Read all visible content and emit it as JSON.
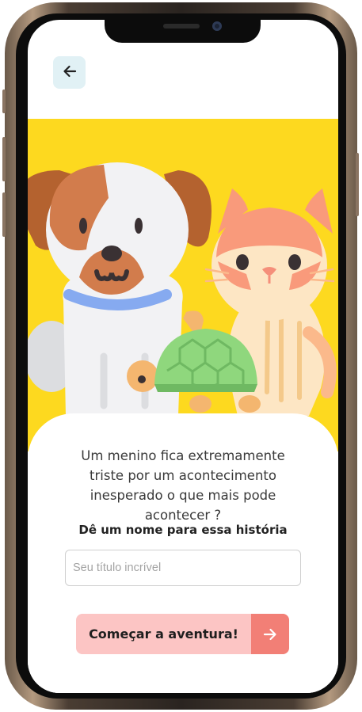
{
  "header": {
    "back_icon": "arrow-left-icon",
    "back_bg": "#e1f1f5"
  },
  "hero": {
    "background": "#fdd91f",
    "animals": [
      "dog",
      "cat",
      "turtle"
    ]
  },
  "story": {
    "prompt": "Um menino fica extremamente triste por um acontecimento inesperado o que mais pode acontecer ?"
  },
  "form": {
    "name_label": "Dê um nome para essa história",
    "title_placeholder": "Seu título incrível",
    "title_value": ""
  },
  "cta": {
    "label": "Começar a aventura!",
    "icon": "arrow-right-icon",
    "colors": {
      "button": "#fcc5c4",
      "arrow_panel": "#f27f76"
    }
  }
}
